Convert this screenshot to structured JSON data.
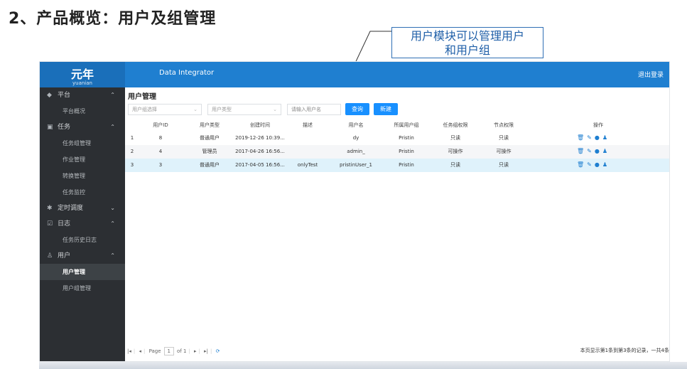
{
  "slide": {
    "title": "2、产品概览：用户及组管理",
    "callout_line1": "用户模块可以管理用户",
    "callout_line2": "和用户组"
  },
  "header": {
    "logo_cn": "元年",
    "logo_en": "yuanian",
    "app_name": "Data Integrator",
    "logout": "退出登录"
  },
  "sidebar": {
    "groups": [
      {
        "label": "平台",
        "icon": "layers-icon",
        "chevron": "^",
        "items": [
          "平台概况"
        ]
      },
      {
        "label": "任务",
        "icon": "calendar-icon",
        "chevron": "^",
        "items": [
          "任务组管理",
          "作业管理",
          "转换管理",
          "任务监控"
        ]
      },
      {
        "label": "定时调度",
        "icon": "gear-icon",
        "chevron": "v",
        "items": []
      },
      {
        "label": "日志",
        "icon": "edit-icon",
        "chevron": "^",
        "items": [
          "任务历史日志"
        ]
      },
      {
        "label": "用户",
        "icon": "user-icon",
        "chevron": "^",
        "items": [
          "用户管理",
          "用户组管理"
        ]
      }
    ],
    "active_item": "用户管理"
  },
  "main": {
    "page_title": "用户管理",
    "filters": {
      "group_select": "用户组选择",
      "type_select": "用户类型",
      "username_placeholder": "请输入用户名",
      "query_button": "查询",
      "new_button": "新建"
    },
    "table": {
      "columns": [
        "",
        "用户ID",
        "用户类型",
        "创建时间",
        "描述",
        "用户名",
        "所属用户组",
        "任务组权限",
        "节点权限",
        "操作"
      ],
      "rows": [
        [
          "1",
          "8",
          "普通用户",
          "2019-12-26 10:39...",
          "",
          "dy",
          "Pristin",
          "只读",
          "只读"
        ],
        [
          "2",
          "4",
          "管理员",
          "2017-04-26 16:56...",
          "",
          "admin_",
          "Pristin",
          "可操作",
          "可操作"
        ],
        [
          "3",
          "3",
          "普通用户",
          "2017-04-05 16:56...",
          "onlyTest",
          "pristinUser_1",
          "Pristin",
          "只读",
          "只读"
        ]
      ],
      "row_actions": [
        "delete-icon",
        "edit-icon",
        "circle-icon",
        "users-icon"
      ]
    },
    "pager": {
      "page_label": "Page",
      "page_value": "1",
      "of_label": "of 1",
      "summary": "本页显示第1条到第3条的记录，一共4条"
    }
  },
  "colors": {
    "topbar": "#1f7fd0",
    "sidebar": "#2c2f33",
    "primary_button": "#1890ff",
    "highlight_row": "#dff2fb"
  }
}
